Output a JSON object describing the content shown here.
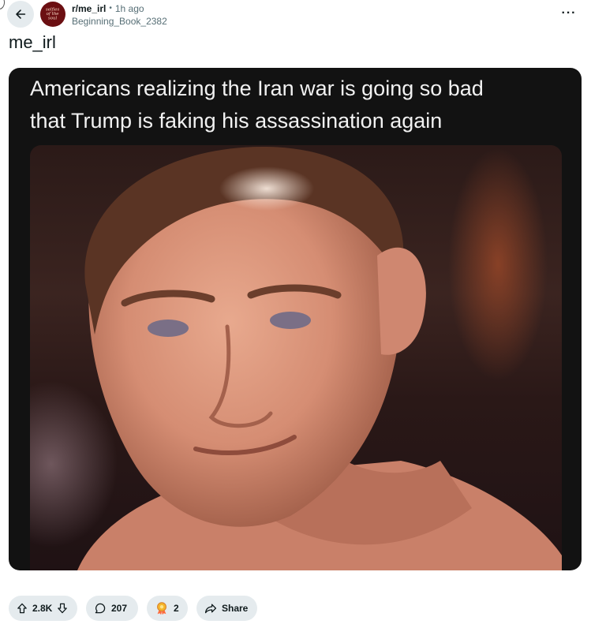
{
  "header": {
    "subreddit": "r/me_irl",
    "separator": "•",
    "time_ago": "1h ago",
    "author": "Beginning_Book_2382",
    "avatar_text": "selfies\nof the\nsoul",
    "more_label": "···"
  },
  "post": {
    "title": "me_irl",
    "meme_caption": "Americans realizing the Iran war is going so bad\nthat Trump is faking his assassination again"
  },
  "actions": {
    "score": "2.8K",
    "comments": "207",
    "awards": "2",
    "share_label": "Share"
  },
  "icons": {
    "back": "arrow-left-icon",
    "more": "more-horizontal-icon",
    "upvote": "arrow-up-icon",
    "downvote": "arrow-down-icon",
    "comment": "speech-bubble-icon",
    "award": "award-icon",
    "share": "share-arrow-icon",
    "mute": "muted-speaker-icon"
  },
  "colors": {
    "pill_background": "#e5ebee",
    "text_primary": "#0f1a1c",
    "text_muted": "#576f76",
    "avatar_background": "#6b0f12",
    "media_background": "#121212"
  }
}
